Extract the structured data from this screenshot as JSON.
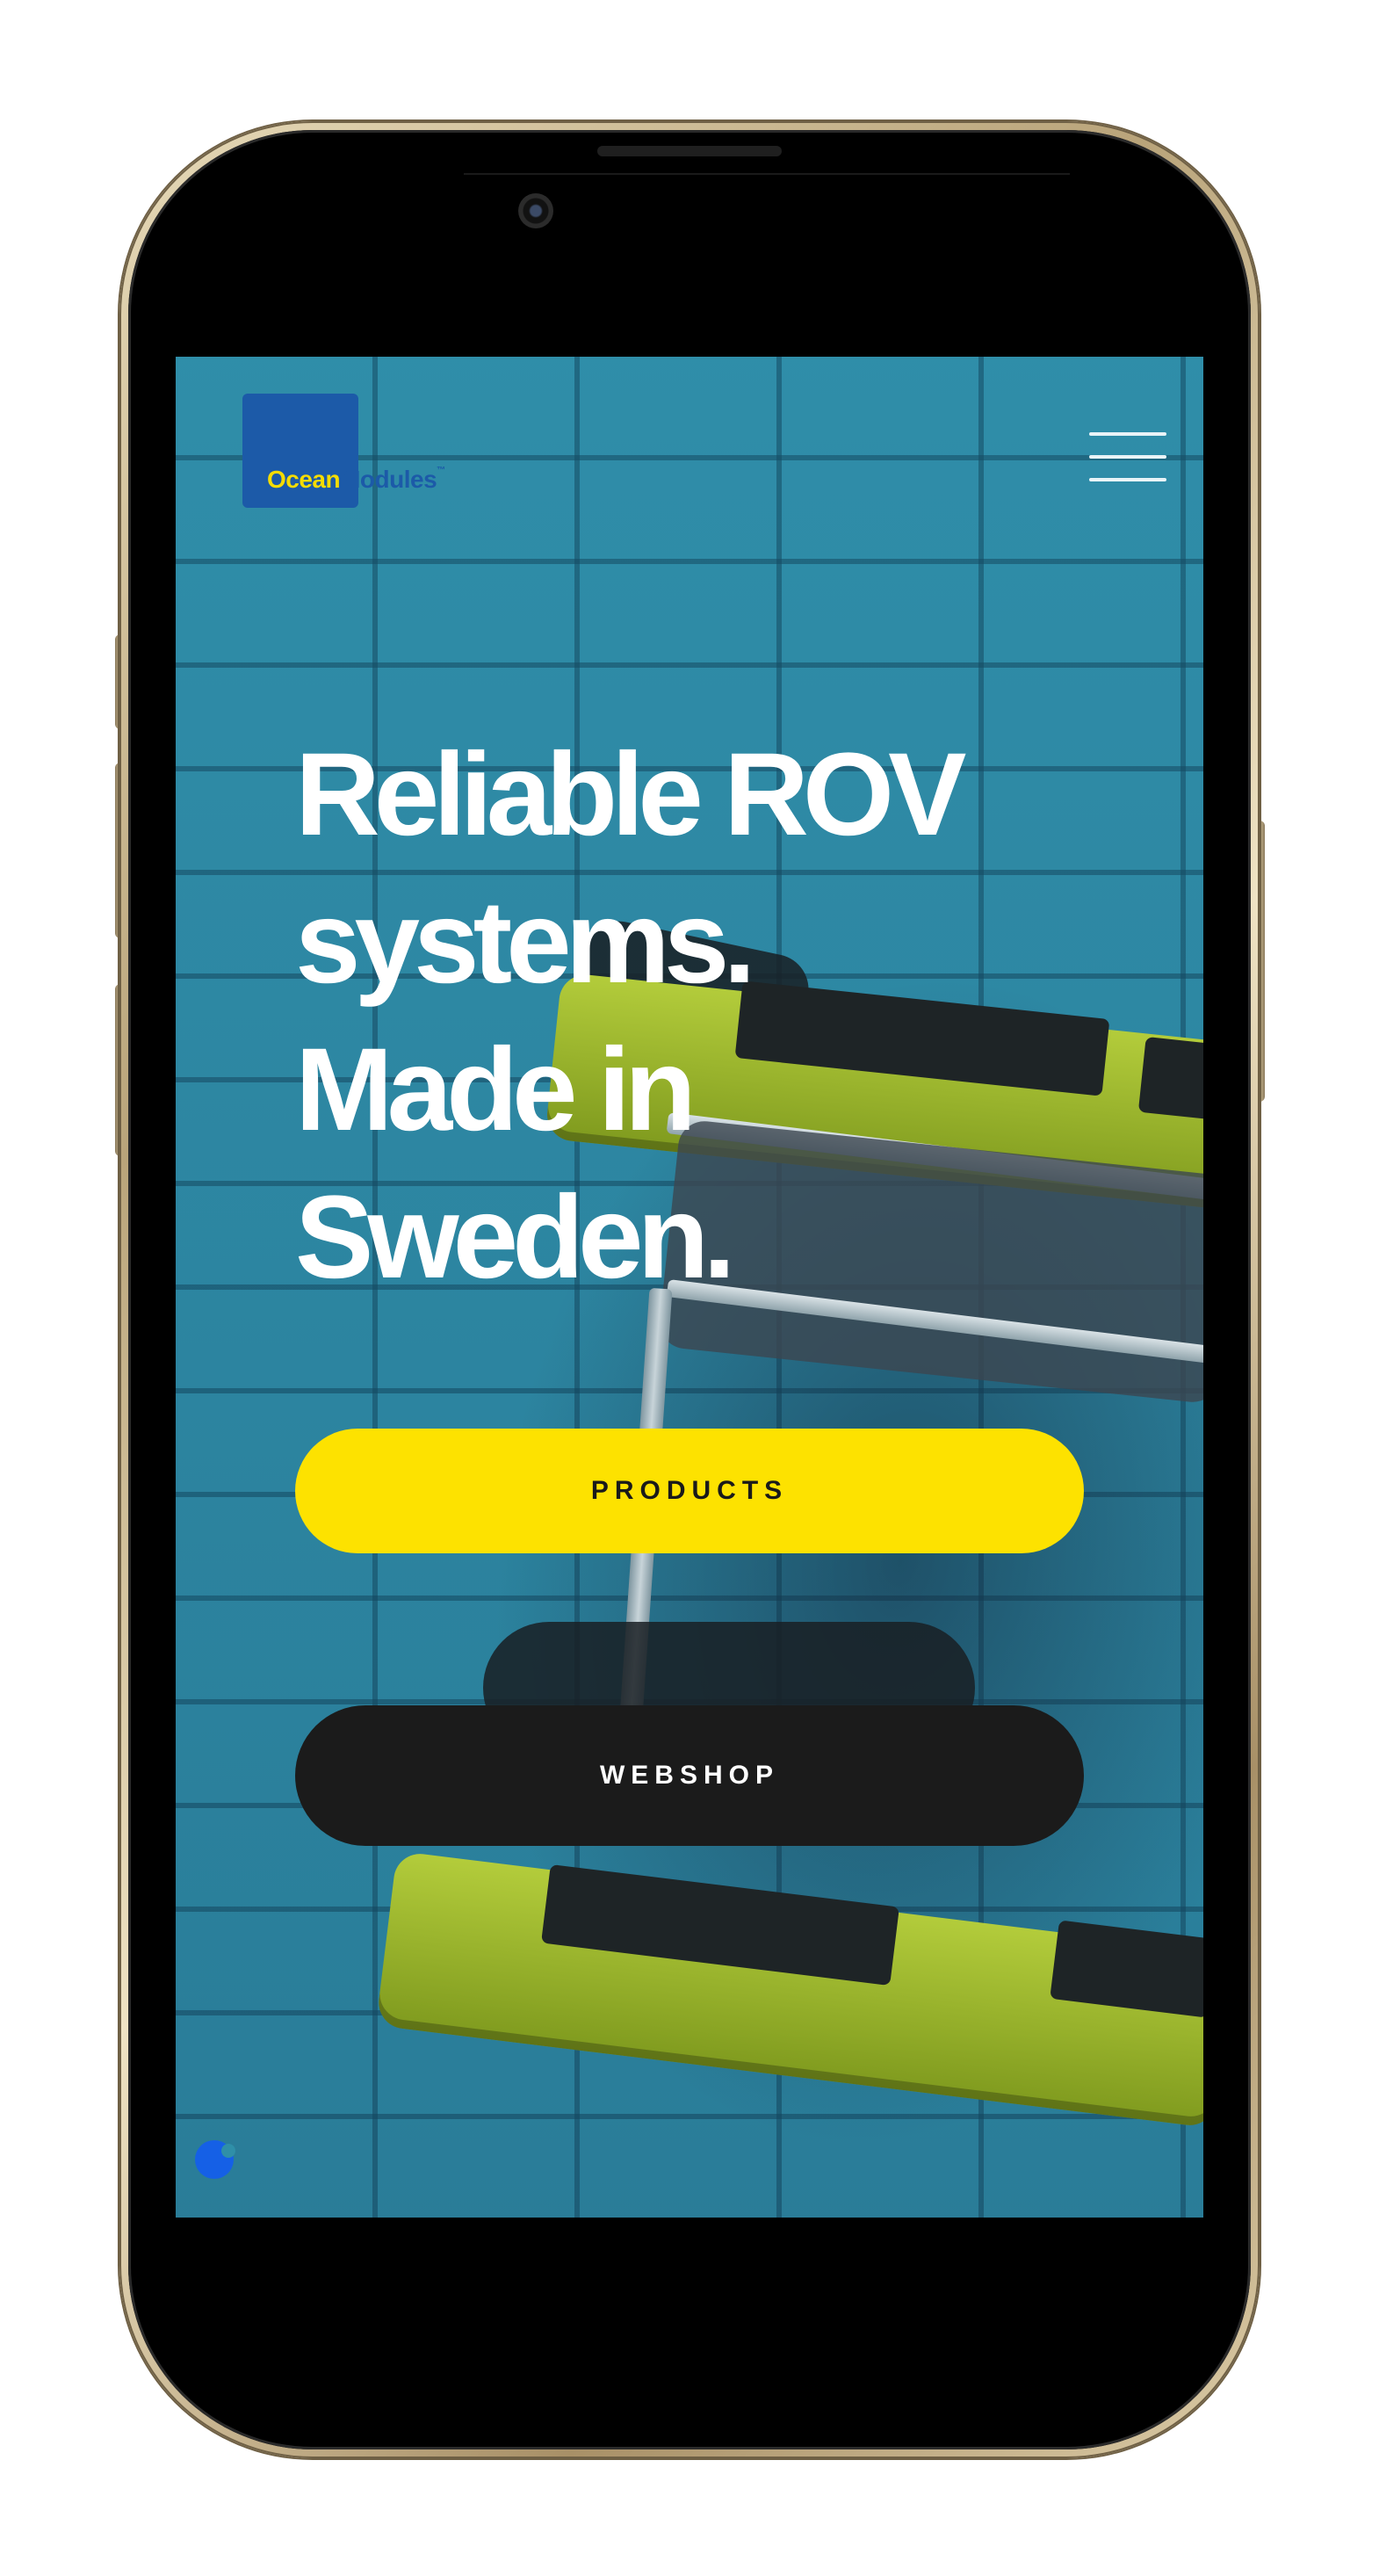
{
  "header": {
    "logo": {
      "word1": "Ocean",
      "word2": "Modules",
      "trademark": "™"
    },
    "menu_icon": "hamburger-menu-icon"
  },
  "hero": {
    "headline": [
      "Reliable ROV",
      "systems.",
      "Made in",
      "Sweden."
    ],
    "background": "underwater-rov-video"
  },
  "buttons": {
    "products_label": "PRODUCTS",
    "webshop_label": "WEBSHOP"
  },
  "cookie": {
    "icon": "cookie-settings-icon"
  },
  "colors": {
    "accent_yellow": "#fde200",
    "brand_blue": "#1c5aa8",
    "dark_button": "#1b1b1b",
    "water": "#3399b3",
    "cookie_blue": "#1560e6"
  }
}
